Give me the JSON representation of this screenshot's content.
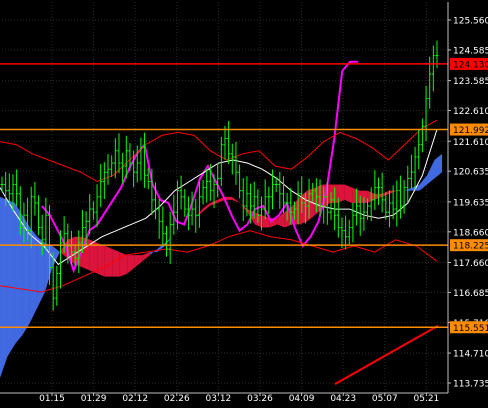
{
  "chart_data": {
    "type": "line",
    "title": "",
    "xlabel": "",
    "ylabel": "",
    "x_ticks": [
      "01.15",
      "01.29",
      "02.12",
      "02.26",
      "03.12",
      "03.26",
      "04.09",
      "04.23",
      "05.07",
      "05.21"
    ],
    "y_ticks": [
      125.56,
      124.585,
      123.585,
      122.61,
      121.61,
      120.635,
      119.635,
      118.66,
      117.66,
      116.685,
      115.71,
      114.71,
      113.735
    ],
    "ylim": [
      113.735,
      125.56
    ],
    "grid": true,
    "horizontal_levels": [
      {
        "value": 124.13,
        "label": "124.130",
        "color": "#ff0000"
      },
      {
        "value": 121.992,
        "label": "121.992",
        "color": "#ff8c00"
      },
      {
        "value": 118.225,
        "label": "118.225",
        "color": "#ff8c00"
      },
      {
        "value": 115.551,
        "label": "115.551",
        "color": "#ff8c00"
      }
    ],
    "series": [
      {
        "kind": "price",
        "color": "#00ff00",
        "values": [
          120.2,
          120.0,
          119.9,
          120.2,
          119.9,
          118.8,
          119.2,
          118.7,
          119.8,
          119.6,
          118.8,
          118.4,
          119.2,
          117.5,
          116.5,
          117.3,
          118.3,
          118.6,
          118.2,
          118.0,
          117.8,
          118.3,
          118.8,
          119.0,
          119.4,
          119.3,
          119.8,
          120.3,
          120.6,
          120.7,
          120.9,
          121.3,
          120.9,
          120.8,
          121.3,
          120.9,
          120.6,
          120.9,
          121.4,
          120.5,
          120.3,
          119.7,
          119.4,
          119.0,
          118.6,
          118.1,
          118.9,
          119.3,
          120.0,
          119.8,
          119.4,
          119.2,
          119.4,
          119.2,
          119.8,
          120.1,
          120.3,
          120.0,
          120.2,
          120.4,
          121.5,
          121.7,
          121.2,
          121.1,
          120.6,
          120.0,
          119.5,
          119.9,
          119.5,
          119.8,
          119.2,
          119.4,
          119.8,
          119.8,
          120.2,
          120.2,
          119.9,
          119.6,
          119.6,
          119.3,
          119.4,
          119.9,
          119.6,
          119.5,
          119.9,
          120.0,
          119.8,
          119.5,
          119.8,
          119.3,
          119.7,
          119.2,
          118.8,
          118.7,
          118.5,
          118.8,
          119.2,
          119.5,
          119.1,
          119.3,
          119.5,
          119.7,
          120.1,
          120.1,
          119.7,
          119.3,
          119.6,
          119.4,
          120.0,
          119.5,
          120.1,
          120.4,
          120.6,
          121.1,
          121.5,
          122.1,
          123.0,
          123.8,
          124.4,
          124.4
        ]
      },
      {
        "kind": "moving-average",
        "color": "#ff00ff",
        "values": [
          119.5,
          119.2,
          118.7,
          118.2,
          117.4,
          118.0,
          118.7,
          118.9,
          119.3,
          119.7,
          120.1,
          120.7,
          121.2,
          121.5,
          120.2,
          119.7,
          119.6,
          119.0,
          118.9,
          119.6,
          120.4,
          120.8,
          120.3,
          119.8,
          119.2,
          118.7,
          118.9,
          119.4,
          119.5,
          119.0,
          119.2,
          119.6,
          118.8,
          118.2,
          118.5,
          119.0,
          120.0,
          121.7,
          123.9,
          124.2,
          124.2
        ]
      },
      {
        "kind": "moving-average",
        "color": "#ffffff",
        "values": [
          120.1,
          119.3,
          118.6,
          118.2,
          117.6,
          117.9,
          118.2,
          118.5,
          118.7,
          118.9,
          119.1,
          119.5,
          120.0,
          120.3,
          120.6,
          120.9,
          121.0,
          120.9,
          120.7,
          120.4,
          120.0,
          119.7,
          119.5,
          119.4,
          119.4,
          119.2,
          119.1,
          119.2,
          119.6,
          120.5,
          122.0
        ]
      },
      {
        "kind": "band-upper",
        "color": "#ff0000",
        "values": [
          121.6,
          121.5,
          121.2,
          121.0,
          120.8,
          120.6,
          120.3,
          120.5,
          121.0,
          121.5,
          121.8,
          121.9,
          121.8,
          121.3,
          121.0,
          121.2,
          121.3,
          120.8,
          120.7,
          121.1,
          121.6,
          121.9,
          121.7,
          121.4,
          121.0,
          121.5,
          122.0,
          122.3
        ]
      },
      {
        "kind": "band-lower",
        "color": "#ff0000",
        "values": [
          116.9,
          116.8,
          116.7,
          116.9,
          117.2,
          117.5,
          117.9,
          118.0,
          118.1,
          118.0,
          118.2,
          118.5,
          118.7,
          118.5,
          118.4,
          118.2,
          118.0,
          118.2,
          118.0,
          118.4,
          118.2,
          117.7
        ]
      },
      {
        "kind": "trend",
        "color": "#ff0000",
        "values": [
          113.7,
          115.6
        ]
      }
    ],
    "cloud": {
      "span_a": [
        119.8,
        119.7,
        119.6,
        119.2,
        118.8,
        118.5,
        118.3,
        118.2,
        118.0,
        117.8,
        117.6,
        117.5,
        117.4,
        117.3,
        117.2,
        117.2,
        117.2,
        117.3,
        117.5,
        117.7,
        117.9,
        118.1,
        118.3,
        118.5,
        118.7,
        118.9,
        119.1,
        119.3,
        119.5,
        119.6,
        119.7,
        119.7,
        119.6,
        119.3,
        118.9,
        118.8,
        118.8,
        118.9,
        118.8,
        118.9,
        118.9,
        119.0,
        119.2,
        119.4,
        119.6,
        119.6,
        119.7,
        119.6,
        119.6,
        119.6,
        119.7,
        119.8,
        119.9,
        120.0,
        120.0,
        120.1,
        120.2,
        120.5,
        121.0,
        121.2
      ],
      "span_b": [
        113.9,
        114.6,
        115.0,
        115.3,
        115.7,
        116.2,
        116.7,
        117.5,
        118.0,
        118.4,
        118.5,
        118.5,
        118.4,
        118.3,
        118.2,
        118.1,
        118.0,
        117.9,
        117.9,
        117.9,
        118.0,
        118.0,
        118.2,
        118.5,
        118.7,
        118.9,
        119.1,
        119.4,
        119.6,
        119.7,
        119.8,
        119.8,
        119.6,
        119.4,
        119.3,
        119.2,
        119.1,
        119.1,
        119.3,
        119.5,
        119.8,
        120.0,
        120.1,
        120.2,
        120.2,
        120.2,
        120.2,
        120.1,
        120.0,
        120.0,
        119.9,
        119.9,
        120.0,
        120.0,
        120.0,
        120.0,
        120.0,
        120.2,
        120.4,
        120.6
      ],
      "bull_color": "#4169e1",
      "bear_color": "#dc143c"
    }
  }
}
